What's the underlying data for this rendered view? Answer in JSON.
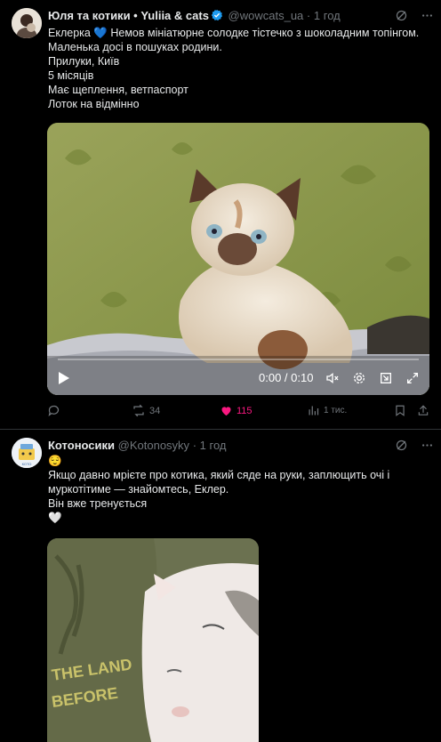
{
  "post1": {
    "author_name": "Юля та котики • Yuliia & cats",
    "handle": "@wowcats_ua",
    "sep": "·",
    "age": "1 год",
    "lines": [
      "Еклерка 💙 Немов мініатюрне солодке тістечко з шоколадним топінгом.",
      "Маленька досі в пошуках родини.",
      "Прилуки, Київ",
      "5 місяців",
      "Має щеплення, ветпаспорт",
      "Лоток на відмінно"
    ],
    "video": {
      "timestamp": "0:00 / 0:10",
      "progress": 0
    },
    "stats": {
      "replies": "",
      "reposts": "34",
      "likes": "115",
      "views": "1 тис."
    }
  },
  "post2": {
    "author_name": "Котоносики",
    "handle": "@Kotonosyky",
    "sep": "·",
    "age": "1 год",
    "avatar_text": "КОТО",
    "lines": [
      "😌",
      "Якщо давно мрієте про котика, який сяде на руки, заплющить очі і",
      "муркотітиме — знайомтесь, Еклер.",
      "Він вже тренується",
      "🤍"
    ],
    "hoodie_text_1": "THE LAND",
    "hoodie_text_2": "BEFORE"
  },
  "colors": {
    "like_active": "#f91880",
    "verified": "#1d9bf0",
    "muted": "#71767b"
  }
}
